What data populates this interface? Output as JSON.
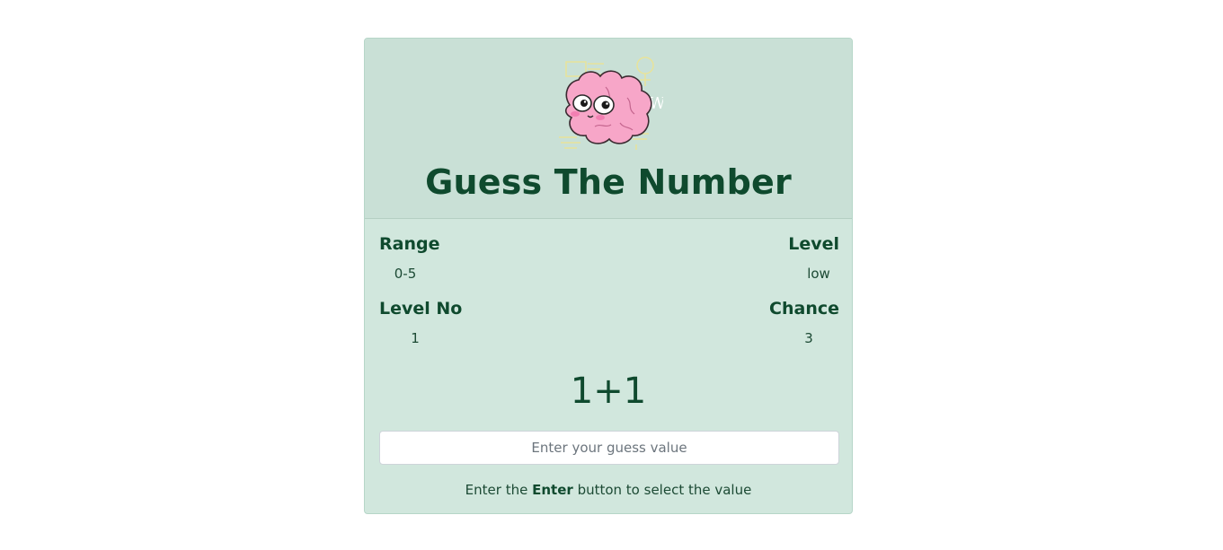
{
  "game": {
    "title": "Guess The Number",
    "logo_icon": "brain-icon",
    "stats": {
      "range_label": "Range",
      "range_value": "0-5",
      "level_label": "Level",
      "level_value": "low",
      "level_no_label": "Level No",
      "level_no_value": "1",
      "chance_label": "Chance",
      "chance_value": "3"
    },
    "equation": "1+1",
    "input": {
      "value": "",
      "placeholder": "Enter your guess value"
    },
    "hint": {
      "prefix": "Enter the",
      "key": "Enter",
      "suffix": "button to select the value"
    }
  },
  "colors": {
    "card_bg": "#d1e7dd",
    "header_bg": "#c9e0d6",
    "text": "#0f4a2e",
    "brain": "#f7a6c8"
  }
}
